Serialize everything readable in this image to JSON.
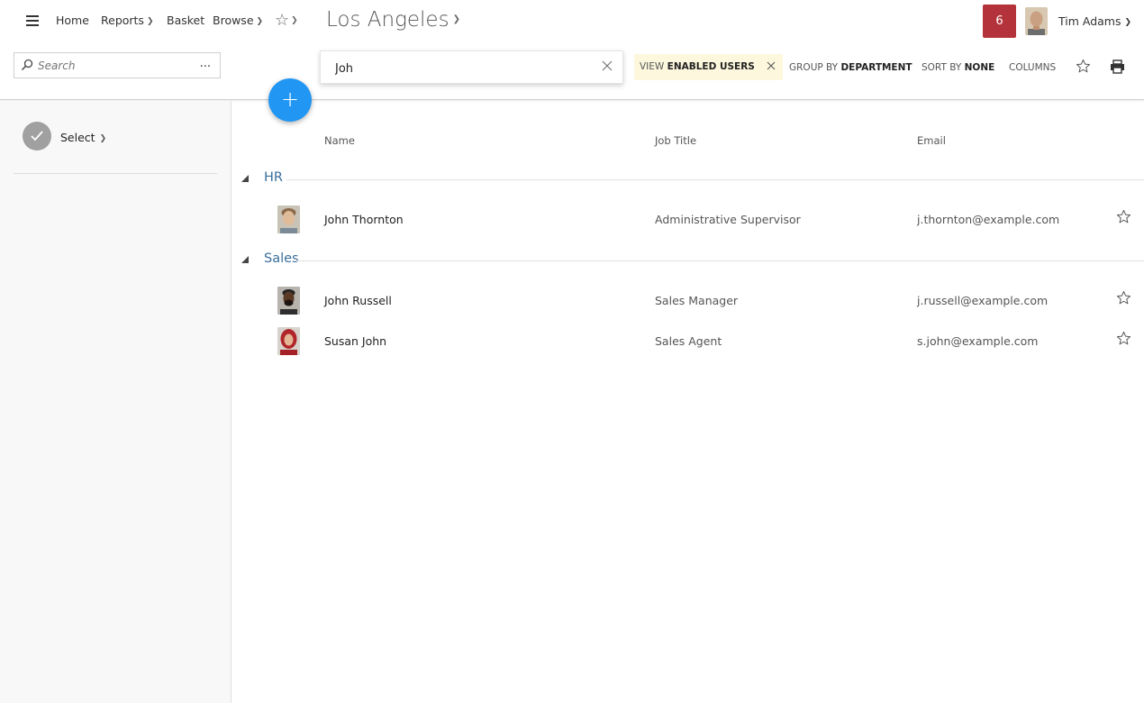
{
  "nav": {
    "links": [
      "Home",
      "Reports",
      "Basket",
      "Browse"
    ],
    "city": "Los Angeles",
    "notification_count": "6",
    "user_name": "Tim Adams"
  },
  "toolbar": {
    "search_placeholder": "Search",
    "search_more": "...",
    "filter_value": "Joh",
    "view_prefix": "VIEW",
    "view_value": "ENABLED USERS",
    "group_prefix": "GROUP BY",
    "group_value": "DEPARTMENT",
    "sort_prefix": "SORT BY",
    "sort_value": "NONE",
    "columns_label": "COLUMNS",
    "add_label": "+"
  },
  "sidebar": {
    "select_label": "Select"
  },
  "table": {
    "columns": [
      "Name",
      "Job Title",
      "Email"
    ],
    "groups": [
      {
        "name": "HR",
        "rows": [
          {
            "name": "John Thornton",
            "job_title": "Administrative Supervisor",
            "email": "j.thornton@example.com"
          }
        ]
      },
      {
        "name": "Sales",
        "rows": [
          {
            "name": "John Russell",
            "job_title": "Sales Manager",
            "email": "j.russell@example.com"
          },
          {
            "name": "Susan John",
            "job_title": "Sales Agent",
            "email": "s.john@example.com"
          }
        ]
      }
    ]
  },
  "colors": {
    "accent_blue": "#2196f3",
    "notification_red": "#b4323a",
    "group_blue": "#3a6e9c",
    "chip_bg": "#fdf8dd"
  },
  "icons": [
    "menu-icon",
    "chevron-down-icon",
    "star-icon",
    "search-icon",
    "close-icon",
    "print-icon",
    "check-icon",
    "collapse-triangle-icon"
  ]
}
